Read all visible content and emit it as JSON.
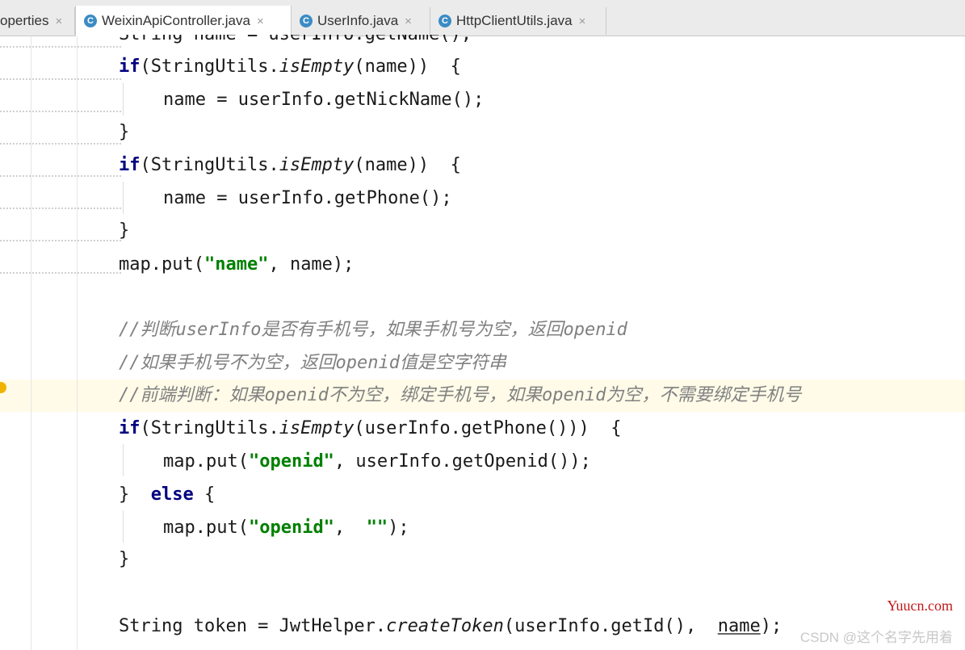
{
  "tabs": [
    {
      "label": "operties",
      "close": "×"
    },
    {
      "label": "WeixinApiController.java",
      "close": "×",
      "icon": "C"
    },
    {
      "label": "UserInfo.java",
      "close": "×",
      "icon": "C"
    },
    {
      "label": "HttpClientUtils.java",
      "close": "×",
      "icon": "C"
    }
  ],
  "code": {
    "l0": "String name = userInfo.getName();",
    "l1": {
      "a": "if",
      "b": "(StringUtils.",
      "c": "isEmpty",
      "d": "(name))  {"
    },
    "l2": "name = userInfo.getNickName();",
    "l3": "}",
    "l4": {
      "a": "if",
      "b": "(StringUtils.",
      "c": "isEmpty",
      "d": "(name))  {"
    },
    "l5": "name = userInfo.getPhone();",
    "l6": "}",
    "l7": {
      "a": "map.put(",
      "b": "\"name\"",
      "c": ", name);"
    },
    "l8": "//判断userInfo是否有手机号，如果手机号为空，返回openid",
    "l9": "//如果手机号不为空，返回openid值是空字符串",
    "l10": "//前端判断：如果openid不为空，绑定手机号，如果openid为空，不需要绑定手机号",
    "l11": {
      "a": "if",
      "b": "(StringUtils.",
      "c": "isEmpty",
      "d": "(userInfo.getPhone()))  {"
    },
    "l12": {
      "a": "map.put(",
      "b": "\"openid\"",
      "c": ", userInfo.getOpenid());"
    },
    "l13": {
      "a": "}  ",
      "b": "else",
      "c": " {"
    },
    "l14": {
      "a": "map.put(",
      "b": "\"openid\"",
      "c": ",  ",
      "d": "\"\"",
      "e": ");"
    },
    "l15": "}",
    "l16": {
      "a": "String token = JwtHelper.",
      "b": "createToken",
      "c": "(userInfo.getId(),  ",
      "d": "name",
      "e": ");"
    }
  },
  "watermark": {
    "site": "Yuucn.com",
    "author": "CSDN @这个名字先用着"
  },
  "colors": {
    "keyword": "#000080",
    "string": "#008000",
    "comment": "#808080",
    "caret_row": "#fffbe8"
  }
}
